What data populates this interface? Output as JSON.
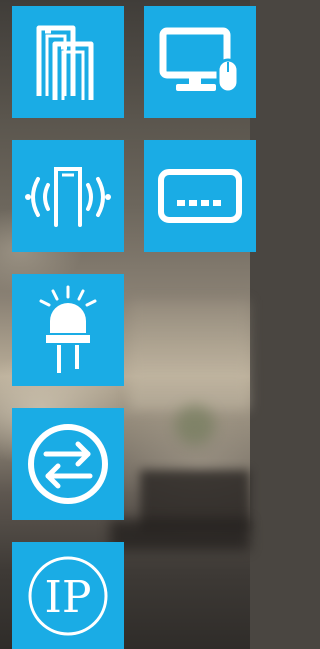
{
  "tiles": [
    {
      "id": "walkthrough-gates",
      "icon": "walkthrough-gate-icon"
    },
    {
      "id": "computer",
      "icon": "monitor-mouse-icon"
    },
    {
      "id": "gate-signal",
      "icon": "gate-signal-icon"
    },
    {
      "id": "password",
      "icon": "password-field-icon"
    },
    {
      "id": "alarm-light",
      "icon": "led-light-icon"
    },
    {
      "id": "direction",
      "icon": "bidirectional-arrows-icon"
    },
    {
      "id": "ip-rating",
      "icon": "ip-rating-icon",
      "label": "IP"
    }
  ],
  "colors": {
    "tile": "#1aace5",
    "icon": "#ffffff"
  }
}
